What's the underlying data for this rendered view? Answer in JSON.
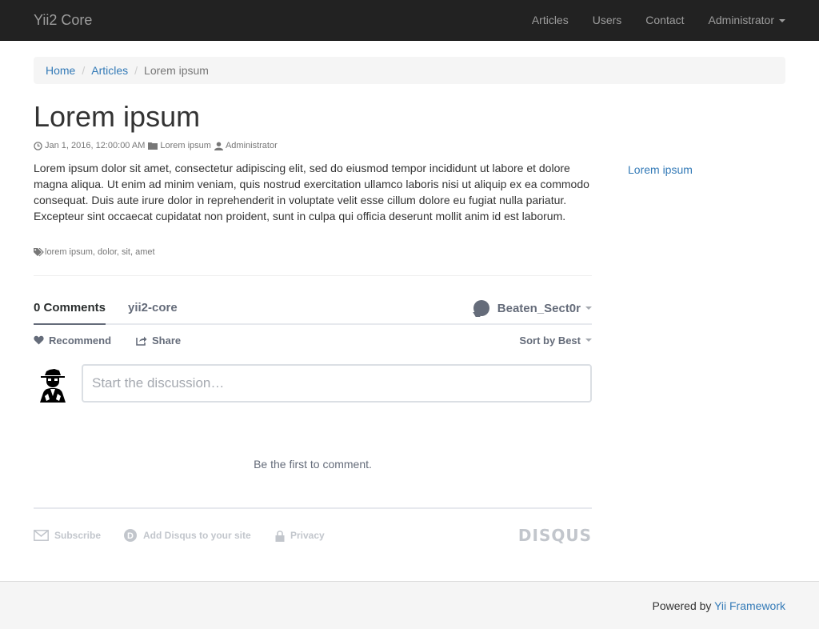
{
  "navbar": {
    "brand": "Yii2 Core",
    "items": [
      {
        "label": "Articles"
      },
      {
        "label": "Users"
      },
      {
        "label": "Contact"
      },
      {
        "label": "Administrator"
      }
    ]
  },
  "breadcrumb": {
    "home": "Home",
    "articles": "Articles",
    "current": "Lorem ipsum",
    "separator": "/"
  },
  "article": {
    "title": "Lorem ipsum",
    "date": "Jan 1, 2016, 12:00:00 AM",
    "category": "Lorem ipsum",
    "author": "Administrator",
    "body": "Lorem ipsum dolor sit amet, consectetur adipiscing elit, sed do eiusmod tempor incididunt ut labore et dolore magna aliqua. Ut enim ad minim veniam, quis nostrud exercitation ullamco laboris nisi ut aliquip ex ea commodo consequat. Duis aute irure dolor in reprehenderit in voluptate velit esse cillum dolore eu fugiat nulla pariatur. Excepteur sint occaecat cupidatat non proident, sunt in culpa qui officia deserunt mollit anim id est laborum.",
    "tags": "lorem ipsum, dolor, sit, amet"
  },
  "sidebar": {
    "link": "Lorem ipsum"
  },
  "disqus": {
    "comments_tab": "0 Comments",
    "forum_tab": "yii2-core",
    "username": "Beaten_Sect0r",
    "recommend": "Recommend",
    "share": "Share",
    "sort": "Sort by Best",
    "placeholder": "Start the discussion…",
    "empty": "Be the first to comment.",
    "subscribe": "Subscribe",
    "add_disqus": "Add Disqus to your site",
    "privacy": "Privacy",
    "logo": "DISQUS"
  },
  "footer": {
    "powered_prefix": "Powered by",
    "powered_link": "Yii Framework"
  }
}
